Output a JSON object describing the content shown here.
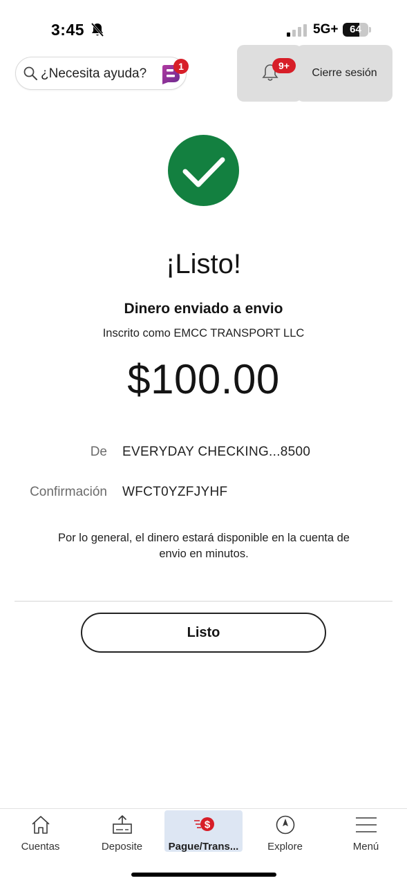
{
  "status_bar": {
    "time": "3:45",
    "network": "5G+",
    "battery": "64",
    "battery_level": 0.64
  },
  "header": {
    "help_placeholder": "¿Necesita ayuda?",
    "fargo_badge": "1",
    "notifications_badge": "9+",
    "logout_label": "Cierre sesión"
  },
  "confirmation": {
    "title": "¡Listo!",
    "subtitle": "Dinero enviado a envio",
    "enrolled_as": "Inscrito como EMCC TRANSPORT LLC",
    "amount": "$100.00",
    "from_label": "De",
    "from_value": "EVERYDAY CHECKING...8500",
    "confirmation_label": "Confirmación",
    "confirmation_value": "WFCT0YZFJYHF",
    "note": "Por lo general, el dinero estará disponible en la cuenta de envio en minutos.",
    "done_label": "Listo"
  },
  "nav": {
    "items": [
      {
        "label": "Cuentas",
        "icon": "home-icon"
      },
      {
        "label": "Deposite",
        "icon": "deposit-icon"
      },
      {
        "label": "Pague/Trans...",
        "icon": "pay-transfer-icon"
      },
      {
        "label": "Explore",
        "icon": "compass-icon"
      },
      {
        "label": "Menú",
        "icon": "menu-icon"
      }
    ],
    "active_index": 2
  },
  "colors": {
    "success_green": "#138040",
    "badge_red": "#d71e28",
    "active_nav_bg": "#dde6f3"
  }
}
